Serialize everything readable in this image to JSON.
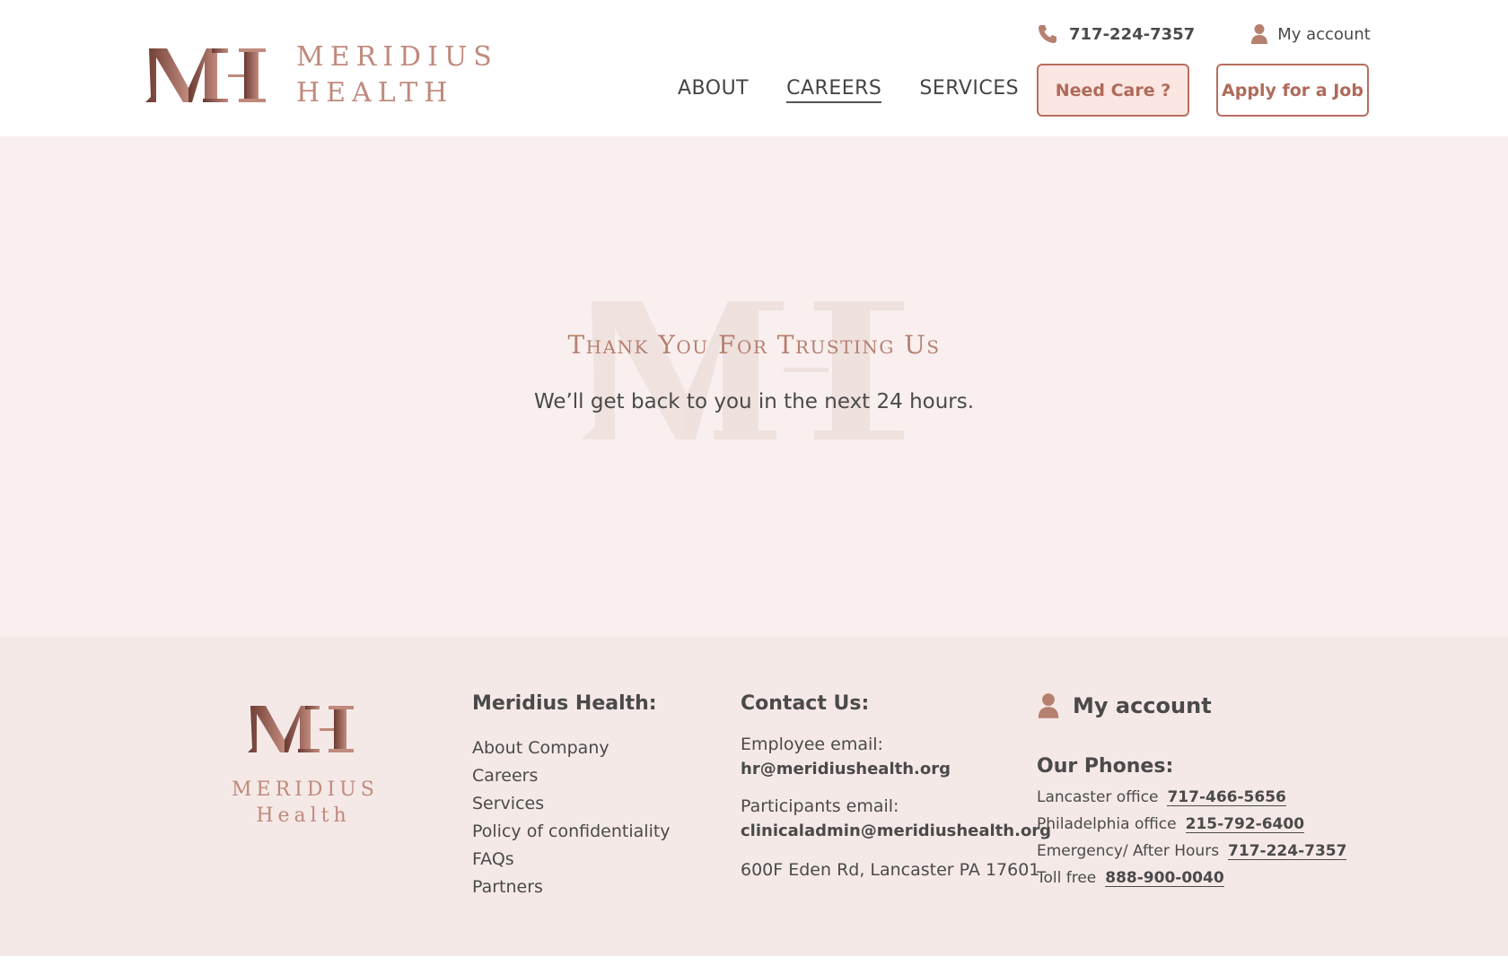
{
  "brand": {
    "name_line1": "MERIDIUS",
    "name_line2": "HEALTH",
    "footer_line1": "MERIDIUS",
    "footer_line2": "Health",
    "accent_color": "#b86e5e",
    "logo_dark": "#6b3a32",
    "logo_light": "#c08a7c"
  },
  "header": {
    "phone": "717-224-7357",
    "account": "My account",
    "nav": [
      {
        "label": "ABOUT"
      },
      {
        "label": "CAREERS"
      },
      {
        "label": "SERVICES"
      }
    ],
    "need_care": "Need Care ?",
    "apply_job": "Apply for a Job"
  },
  "hero": {
    "title": "Thank You For Trusting Us",
    "subtitle": "We’ll get back to you in the next 24 hours."
  },
  "footer": {
    "company": {
      "heading": "Meridius Health:",
      "links": [
        "About Company",
        "Careers",
        "Services",
        "Policy of confidentiality",
        "FAQs",
        "Partners"
      ]
    },
    "contact": {
      "heading": "Contact Us:",
      "employee_label": "Employee email:",
      "employee_email": "hr@meridiushealth.org",
      "participants_label": "Participants email:",
      "participants_email": "clinicaladmin@meridiushealth.org",
      "address": "600F Eden Rd, Lancaster PA 17601"
    },
    "account": "My account",
    "phones": {
      "heading": "Our Phones:",
      "rows": [
        {
          "label": "Lancaster office",
          "number": "717-466-5656"
        },
        {
          "label": "Philadelphia office",
          "number": "215-792-6400"
        },
        {
          "label": "Emergency/ After Hours",
          "number": "717-224-7357"
        },
        {
          "label": "Toll free",
          "number": "888-900-0040"
        }
      ]
    }
  }
}
